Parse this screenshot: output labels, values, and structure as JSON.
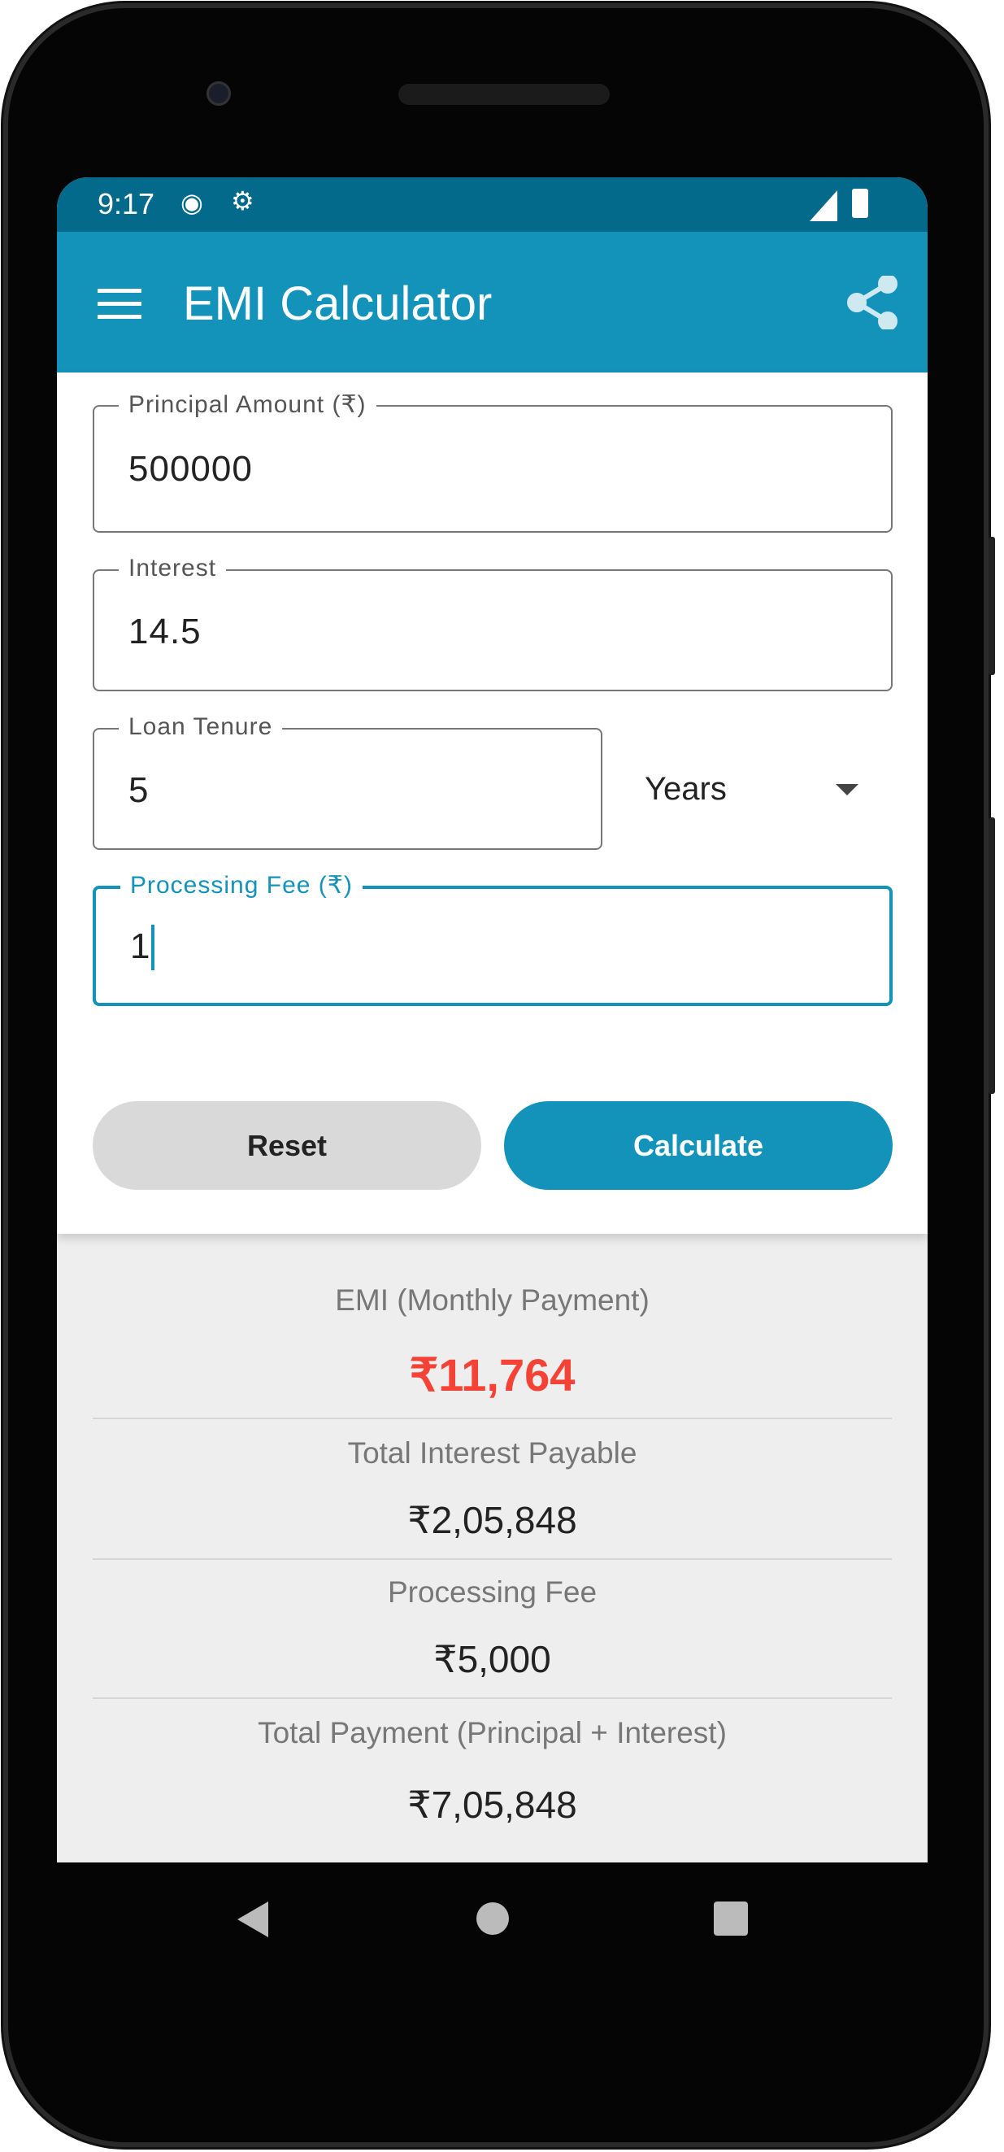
{
  "status_bar": {
    "time": "9:17"
  },
  "app_bar": {
    "title": "EMI Calculator",
    "menu_icon": "hamburger-menu-icon",
    "share_icon": "share-icon"
  },
  "form": {
    "principal": {
      "label": "Principal Amount (₹)",
      "value": "500000"
    },
    "interest": {
      "label": "Interest",
      "value": "14.5"
    },
    "tenure": {
      "label": "Loan Tenure",
      "value": "5",
      "unit": "Years"
    },
    "processing_fee": {
      "label": "Processing Fee (₹)",
      "value": "1"
    },
    "reset_label": "Reset",
    "calculate_label": "Calculate"
  },
  "results": {
    "emi_label": "EMI (Monthly Payment)",
    "emi_value": "₹11,764",
    "interest_label": "Total Interest Payable",
    "interest_value": "₹2,05,848",
    "fee_label": "Processing Fee",
    "fee_value": "₹5,000",
    "total_label": "Total Payment (Principal + Interest)",
    "total_value": "₹7,05,848"
  },
  "colors": {
    "primary": "#1393b9",
    "status": "#036a8b",
    "emi": "#f44336",
    "reset": "#d9d9d9"
  }
}
